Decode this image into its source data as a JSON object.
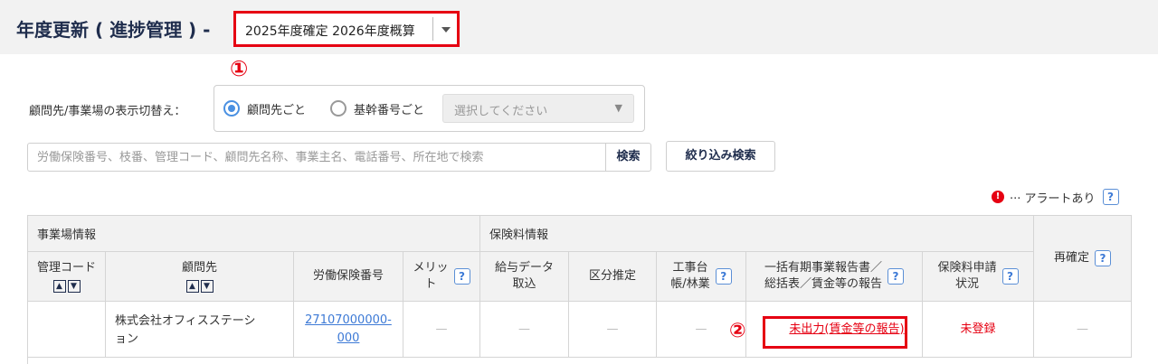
{
  "header": {
    "title": "年度更新 ( 進捗管理 ) -",
    "year_select": "2025年度確定 2026年度概算",
    "marker1": "①",
    "marker2": "②"
  },
  "display_switch": {
    "label": "顧問先/事業場の表示切替え：",
    "option1": "顧問先ごと",
    "option2": "基幹番号ごと",
    "select_placeholder": "選択してください"
  },
  "search": {
    "placeholder": "労働保険番号、枝番、管理コード、顧問先名称、事業主名、電話番号、所在地で検索",
    "button": "検索",
    "filter_button": "絞り込み検索"
  },
  "alert_legend": {
    "icon": "!",
    "text": "··· アラートあり"
  },
  "table": {
    "group1": "事業場情報",
    "group2": "保険料情報",
    "cols": {
      "code": "管理コード",
      "client": "顧問先",
      "insurance_no": "労働保険番号",
      "merit1": "メリッ",
      "merit2": "ト",
      "payroll1": "給与データ",
      "payroll2": "取込",
      "estimate": "区分推定",
      "ledger1": "工事台",
      "ledger2": "帳/林業",
      "report1": "一括有期事業報告書／",
      "report2": "総括表／賃金等の報告",
      "status1": "保険料申請",
      "status2": "状況",
      "reconfirm": "再確定"
    },
    "row": {
      "code": "",
      "client1": "株式会社オフィスステーシ",
      "client2": "ョン",
      "no1": "27107000000-",
      "no2": "000",
      "dash": "—",
      "report": "未出力(賃金等の報告)",
      "status": "未登録"
    }
  }
}
